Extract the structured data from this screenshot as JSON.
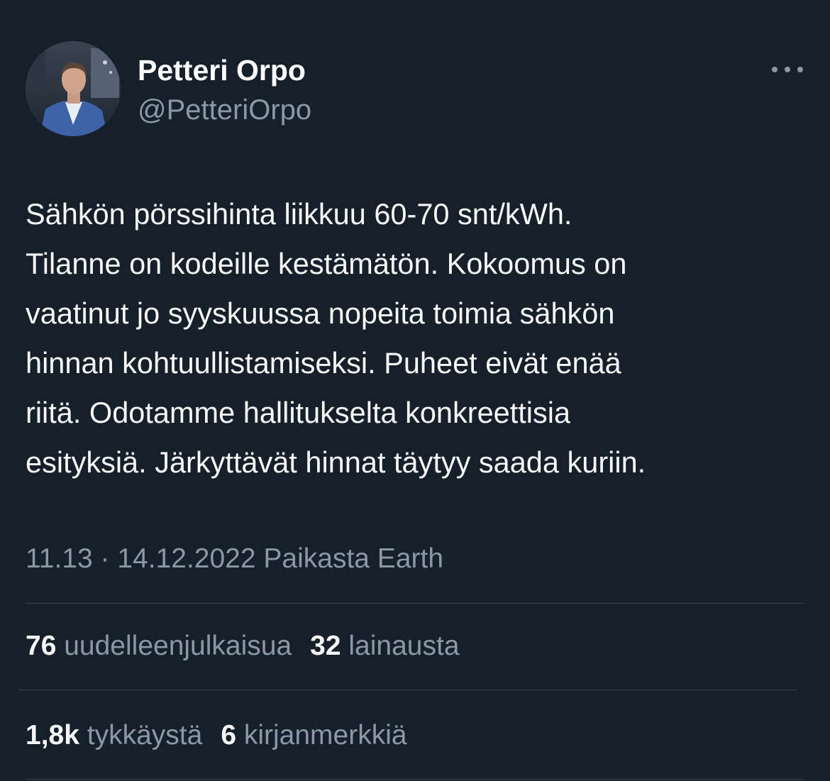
{
  "author": {
    "name": "Petteri Orpo",
    "handle": "@PetteriOrpo"
  },
  "tweet": {
    "text": "Sähkön pörssihinta liikkuu 60-70 snt/kWh.\nTilanne on kodeille kestämätön. Kokoomus on\nvaatinut jo syyskuussa nopeita toimia sähkön\nhinnan kohtuullistamiseksi. Puheet eivät enää\nriitä. Odotamme hallitukselta konkreettisia\nesityksiä. Järkyttävät hinnat täytyy saada kuriin.",
    "meta": "11.13 · 14.12.2022 Paikasta Earth"
  },
  "stats": {
    "retweets_count": "76",
    "retweets_label": "uudelleenjulkaisua",
    "quotes_count": "32",
    "quotes_label": "lainausta",
    "likes_count": "1,8k",
    "likes_label": "tykkäystä",
    "bookmarks_count": "6",
    "bookmarks_label": "kirjanmerkkiä"
  },
  "icons": {
    "more": "more-horizontal-icon"
  },
  "colors": {
    "background": "#15202b",
    "text": "#f7f9f9",
    "secondary": "#8b98a5",
    "divider": "#38444d"
  }
}
